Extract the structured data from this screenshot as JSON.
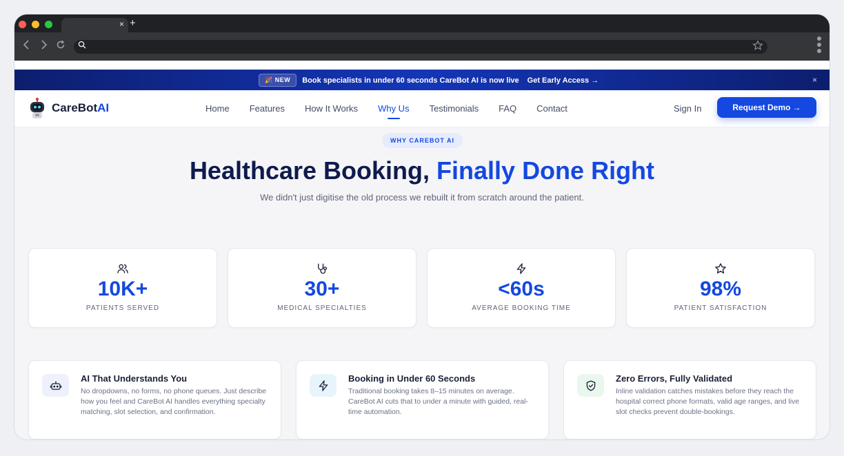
{
  "browser": {
    "tab_close": "×",
    "new_tab": "+"
  },
  "announcement": {
    "badge": "🎉 NEW",
    "text": "Book specialists in under 60 seconds CareBot AI is now live",
    "cta": "Get Early Access →",
    "close": "×"
  },
  "nav": {
    "logo_text": "CareBot",
    "logo_accent": "AI",
    "items": [
      {
        "label": "Home",
        "active": false
      },
      {
        "label": "Features",
        "active": false
      },
      {
        "label": "How It Works",
        "active": false
      },
      {
        "label": "Why Us",
        "active": true
      },
      {
        "label": "Testimonials",
        "active": false
      },
      {
        "label": "FAQ",
        "active": false
      },
      {
        "label": "Contact",
        "active": false
      }
    ],
    "signin": "Sign In",
    "demo": "Request Demo →"
  },
  "hero": {
    "eyebrow": "WHY CAREBOT AI",
    "headline_main": "Healthcare Booking, ",
    "headline_accent": "Finally Done Right",
    "subtitle": "We didn't just digitise the old process we rebuilt it from scratch around the patient."
  },
  "stats": [
    {
      "icon": "users-icon",
      "value": "10K+",
      "label": "PATIENTS SERVED"
    },
    {
      "icon": "stethoscope-icon",
      "value": "30+",
      "label": "MEDICAL SPECIALTIES"
    },
    {
      "icon": "lightning-icon",
      "value": "<60s",
      "label": "AVERAGE BOOKING TIME"
    },
    {
      "icon": "star-icon",
      "value": "98%",
      "label": "PATIENT SATISFACTION"
    }
  ],
  "features": [
    {
      "icon": "bot-icon",
      "title": "AI That Understands You",
      "desc": "No dropdowns, no forms, no phone queues. Just describe how you feel and CareBot AI handles everything specialty matching, slot selection, and confirmation."
    },
    {
      "icon": "lightning-icon",
      "title": "Booking in Under 60 Seconds",
      "desc": "Traditional booking takes 8–15 minutes on average. CareBot AI cuts that to under a minute with guided, real-time automation."
    },
    {
      "icon": "shield-check-icon",
      "title": "Zero Errors, Fully Validated",
      "desc": "Inline validation catches mistakes before they reach the hospital correct phone formats, valid age ranges, and live slot checks prevent double-bookings."
    }
  ],
  "colors": {
    "brand": "#1448e0",
    "navy": "#0f1a4d",
    "feature_icon_bgs": [
      "#eef0fb",
      "#e8f4fb",
      "#eaf7ef"
    ]
  }
}
